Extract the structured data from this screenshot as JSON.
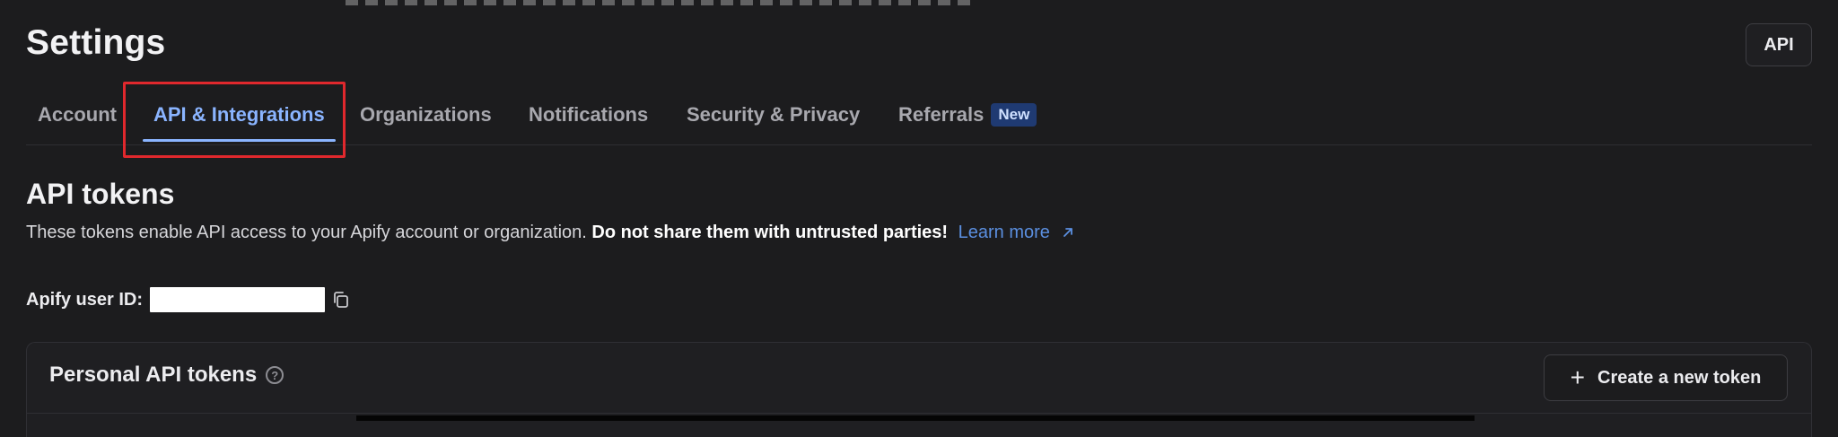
{
  "header": {
    "title": "Settings",
    "api_button_label": "API"
  },
  "tabs": [
    {
      "label": "Account",
      "active": false
    },
    {
      "label": "API & Integrations",
      "active": true
    },
    {
      "label": "Organizations",
      "active": false
    },
    {
      "label": "Notifications",
      "active": false
    },
    {
      "label": "Security & Privacy",
      "active": false
    },
    {
      "label": "Referrals",
      "active": false,
      "badge": "New"
    }
  ],
  "api_tokens": {
    "title": "API tokens",
    "description": "These tokens enable API access to your Apify account or organization.",
    "warning": "Do not share them with untrusted parties!",
    "learn_more": "Learn more",
    "user_id_label": "Apify user ID:",
    "user_id_value": ""
  },
  "personal_tokens": {
    "title": "Personal API tokens",
    "create_button_label": "Create a new token"
  },
  "colors": {
    "background": "#1c1c1e",
    "accent": "#8ab4ff",
    "link": "#5b8fe0",
    "highlight": "#e0282d",
    "badge_bg": "#1f3a72"
  },
  "icons": {
    "copy": "copy-icon",
    "help": "help-circle-icon",
    "plus": "plus-icon",
    "external_link": "external-link-icon"
  }
}
